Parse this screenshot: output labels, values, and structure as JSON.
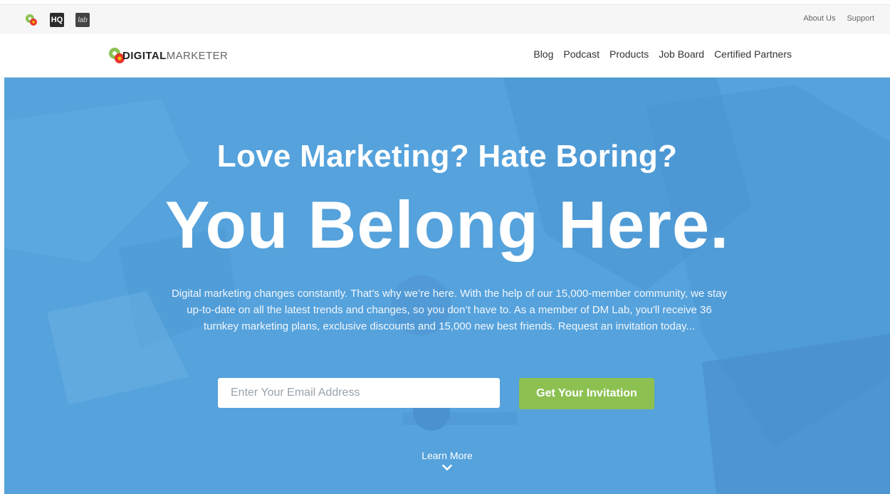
{
  "util_bar": {
    "icons": [
      "gear-logo-icon",
      "hq-icon",
      "lab-icon"
    ],
    "hq_label": "HQ",
    "lab_label": "lab",
    "links": [
      "About Us",
      "Support"
    ]
  },
  "header": {
    "logo_bold": "DIGITAL",
    "logo_light": "MARKETER",
    "nav": [
      "Blog",
      "Podcast",
      "Products",
      "Job Board",
      "Certified Partners"
    ]
  },
  "hero": {
    "kicker": "Love Marketing? Hate Boring?",
    "title": "You Belong Here.",
    "copy": "Digital marketing changes constantly. That’s why we’re here. With the help of our 15,000-member community, we stay up-to-date on all the latest trends and changes, so you don’t have to. As a member of DM Lab, you'll receive 36 turnkey marketing plans, exclusive discounts and 15,000 new best friends. Request an invitation today...",
    "email_placeholder": "Enter Your Email Address",
    "cta_label": "Get Your Invitation",
    "learn_more": "Learn More"
  },
  "colors": {
    "hero_blue": "#56a3dd",
    "cta_green": "#8cc152",
    "logo_green": "#8cc152",
    "logo_red": "#e8352c",
    "logo_yellow": "#f5c400"
  }
}
